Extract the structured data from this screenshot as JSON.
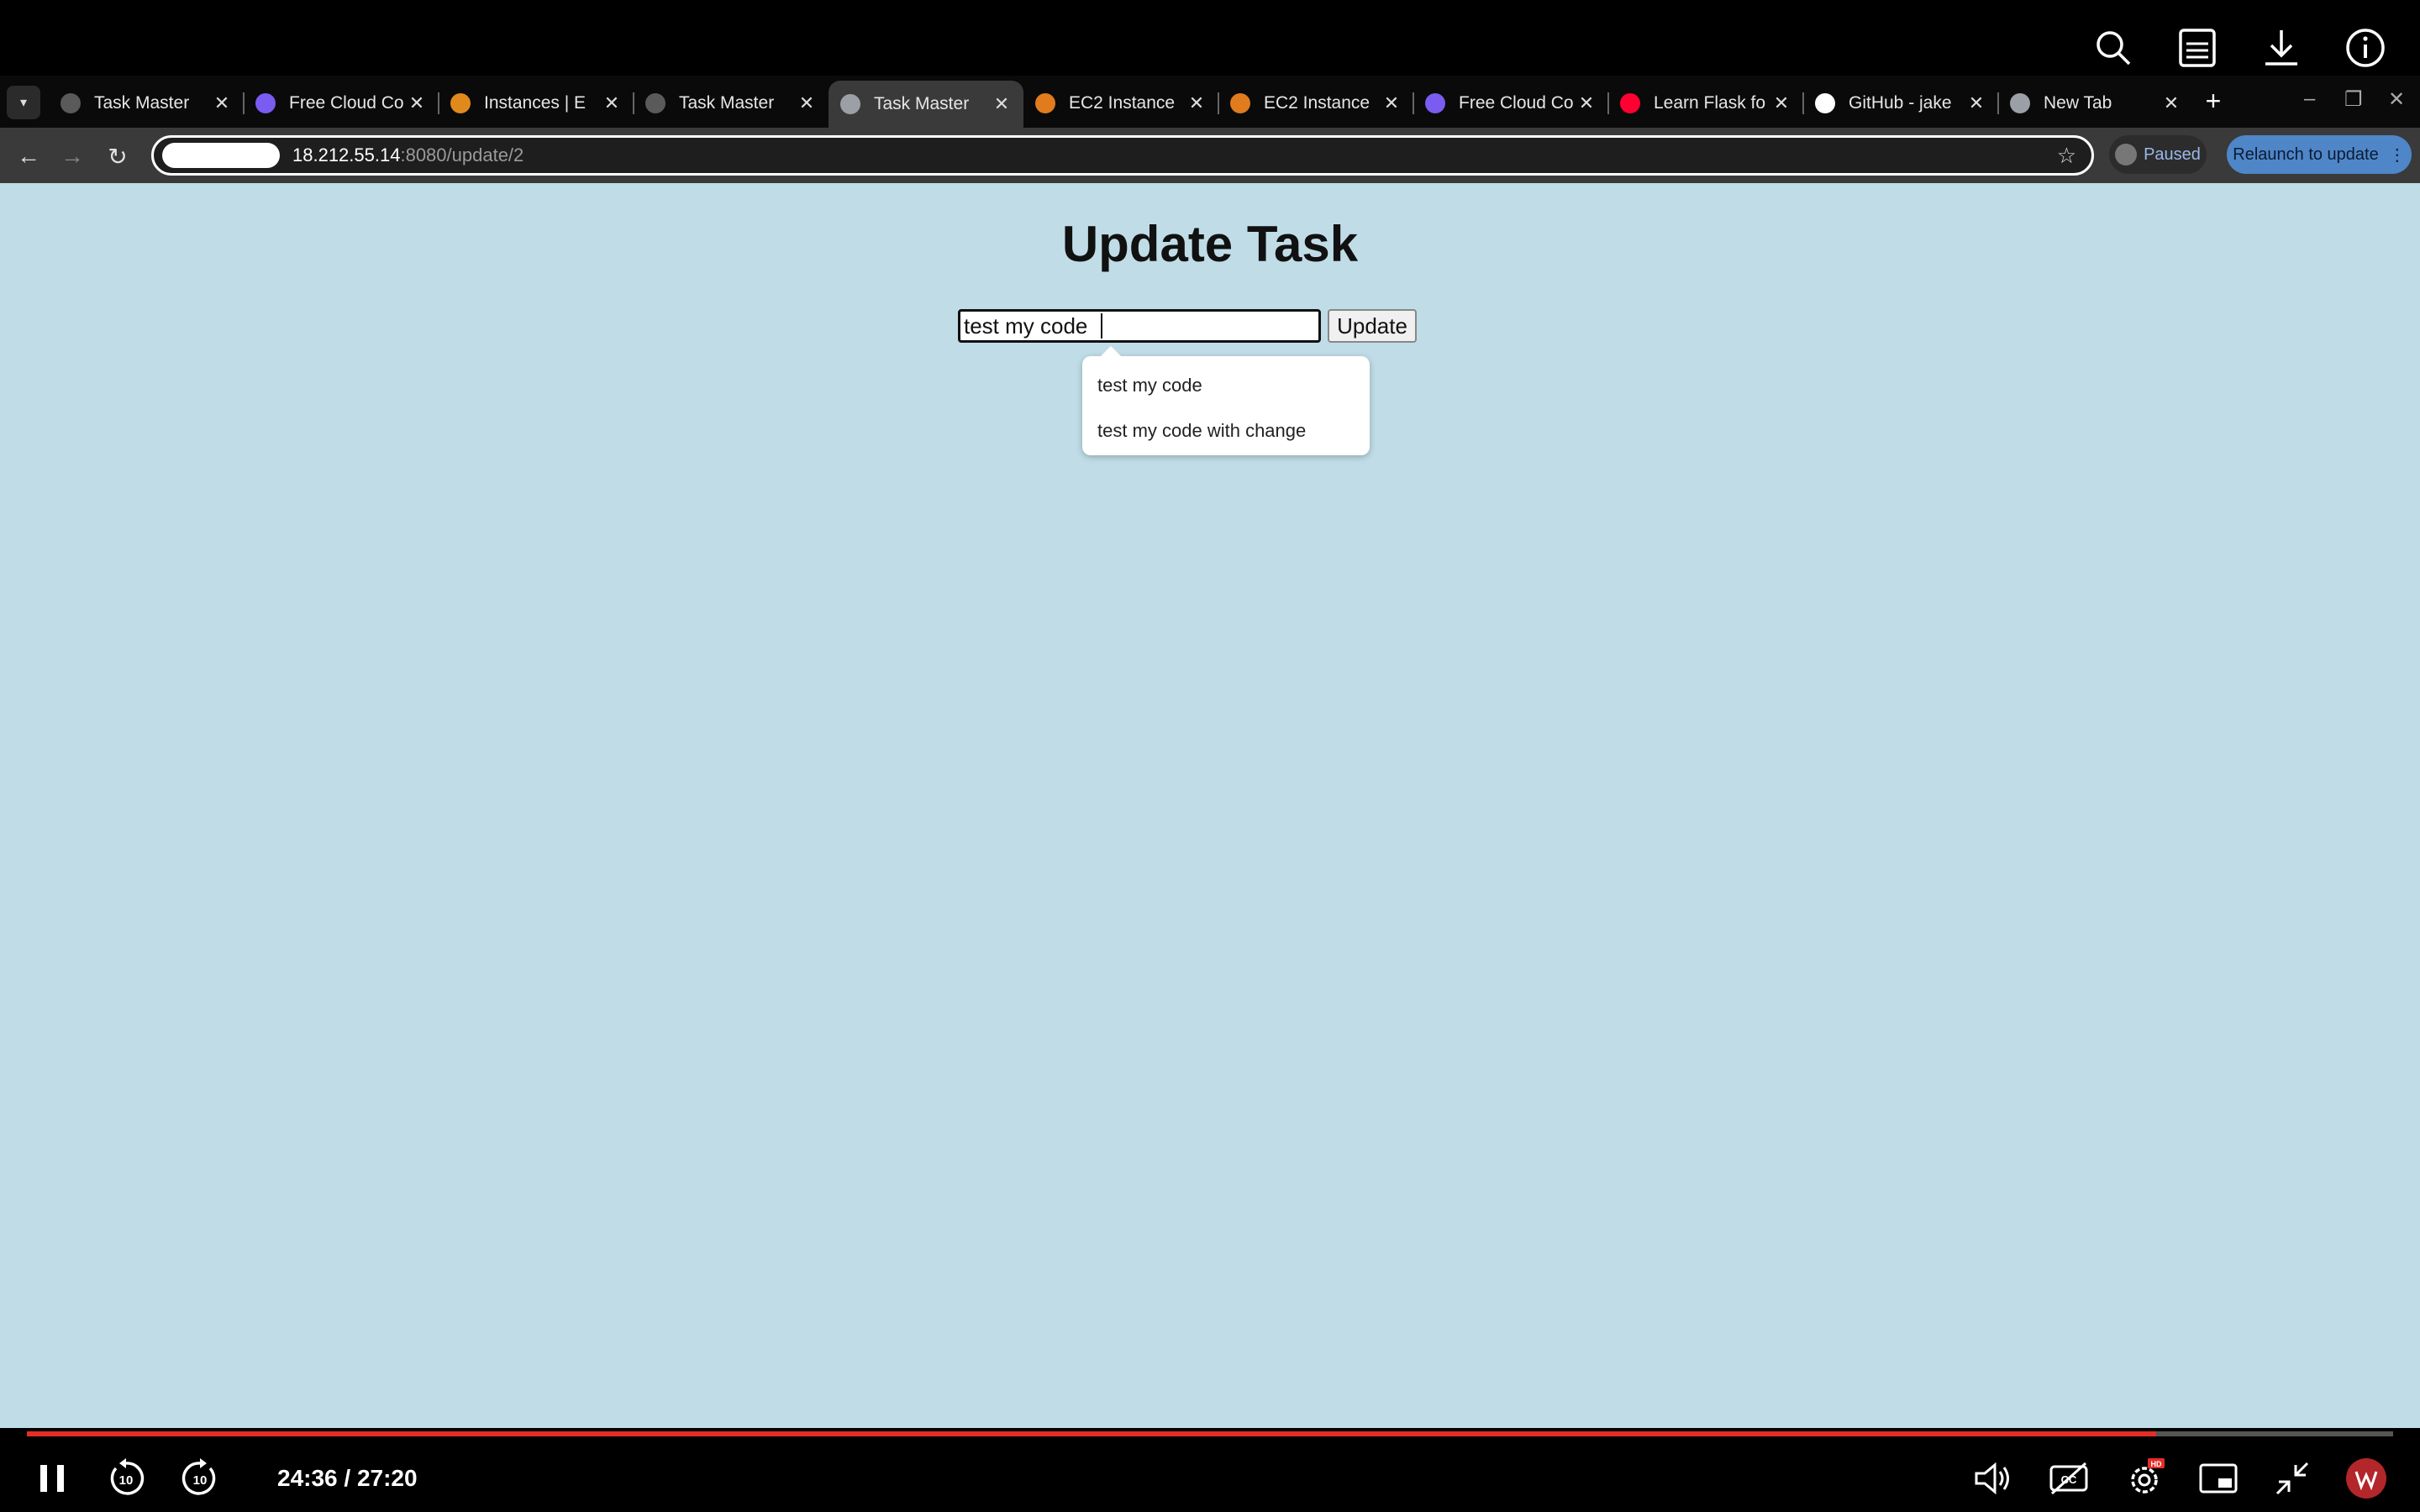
{
  "browser": {
    "tabs": [
      {
        "title": "Task Master",
        "active": false,
        "favicon_color": "#5a5a5a"
      },
      {
        "title": "Free Cloud Co",
        "active": false,
        "favicon_color": "#7a5cf0"
      },
      {
        "title": "Instances | E",
        "active": false,
        "favicon_color": "#e08a1e"
      },
      {
        "title": "Task Master",
        "active": false,
        "favicon_color": "#5a5a5a"
      },
      {
        "title": "Task Master",
        "active": true,
        "favicon_color": "#9aa0a6"
      },
      {
        "title": "EC2 Instance",
        "active": false,
        "favicon_color": "#e07b1e"
      },
      {
        "title": "EC2 Instance",
        "active": false,
        "favicon_color": "#e07b1e"
      },
      {
        "title": "Free Cloud Co",
        "active": false,
        "favicon_color": "#7a5cf0"
      },
      {
        "title": "Learn Flask fo",
        "active": false,
        "favicon_color": "#ff0033"
      },
      {
        "title": "GitHub - jake",
        "active": false,
        "favicon_color": "#ffffff"
      },
      {
        "title": "New Tab",
        "active": false,
        "favicon_color": "#9aa0a6"
      }
    ],
    "url_host": "18.212.55.14",
    "url_path": ":8080/update/2",
    "profile_status": "Paused",
    "relaunch_label": "Relaunch to update"
  },
  "page": {
    "title": "Update Task",
    "input_value": "test my code ",
    "update_button": "Update",
    "suggestions": [
      "test my code",
      "test my code with change"
    ]
  },
  "player": {
    "time": "24:36 / 27:20",
    "progress": 0.9,
    "progress_color": "#e52d27",
    "page_bg": "#c0dde7"
  }
}
